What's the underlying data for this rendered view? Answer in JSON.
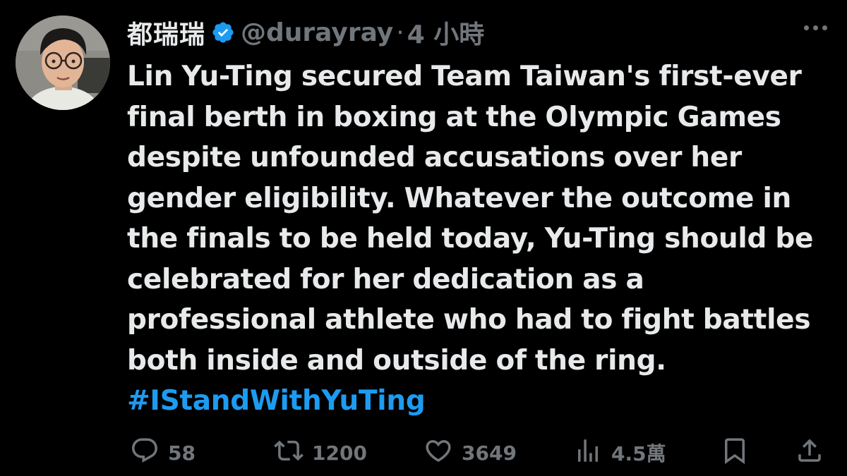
{
  "tweet": {
    "display_name": "都瑞瑞",
    "handle": "@durayray",
    "separator": "·",
    "time": "4 小時",
    "text_lines": [
      "Lin Yu-Ting secured Team Taiwan's first-ever",
      "final berth in boxing at the Olympic Games",
      "despite unfounded accusations over her",
      "gender eligibility. Whatever the outcome in",
      "the finals to be held today, Yu-Ting should be",
      "celebrated for her dedication as a",
      "professional athlete who had to fight battles",
      "both inside and outside of the ring."
    ],
    "hashtag": "#IStandWithYuTing"
  },
  "actions": {
    "replies": "58",
    "retweets": "1200",
    "likes": "3649",
    "views": "4.5萬"
  },
  "icons": [
    "verified-badge-icon",
    "more-icon",
    "reply-icon",
    "retweet-icon",
    "like-icon",
    "views-icon",
    "bookmark-icon",
    "share-icon"
  ],
  "colors": {
    "background": "#000000",
    "text": "#e7e9ea",
    "secondary": "#71767b",
    "accent": "#1d9bf0"
  }
}
